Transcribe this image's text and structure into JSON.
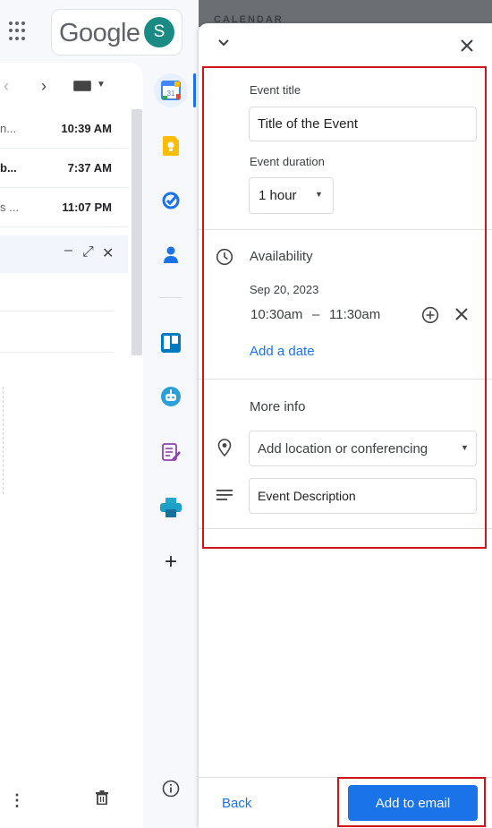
{
  "header": {
    "logo_text": "Google",
    "avatar_initial": "S",
    "calendar_label": "CALENDAR"
  },
  "mail": {
    "rows": [
      {
        "snippet": "n...",
        "time": "10:39 AM",
        "bold": false
      },
      {
        "snippet": "b...",
        "time": "7:37 AM",
        "bold": true
      },
      {
        "snippet": "s ...",
        "time": "11:07 PM",
        "bold": false
      }
    ]
  },
  "event": {
    "title_label": "Event title",
    "title_value": "Title of the Event",
    "duration_label": "Event duration",
    "duration_value": "1 hour",
    "availability_title": "Availability",
    "date": "Sep 20, 2023",
    "start_time": "10:30am",
    "time_separator": "–",
    "end_time": "11:30am",
    "add_date_link": "Add a date",
    "more_info_title": "More info",
    "location_placeholder": "Add location or conferencing",
    "description_value": "Event Description"
  },
  "footer": {
    "back_label": "Back",
    "primary_label": "Add to email"
  },
  "icons": {
    "rail": [
      "google-calendar-icon",
      "google-keep-icon",
      "google-tasks-icon",
      "google-contacts-icon",
      "trello-icon",
      "bot-app-icon",
      "notes-app-icon",
      "printer-app-icon",
      "add-icon",
      "info-icon"
    ]
  },
  "colors": {
    "accent": "#1a73e8",
    "highlight": "#d0121b",
    "avatar": "#1a8a85"
  }
}
